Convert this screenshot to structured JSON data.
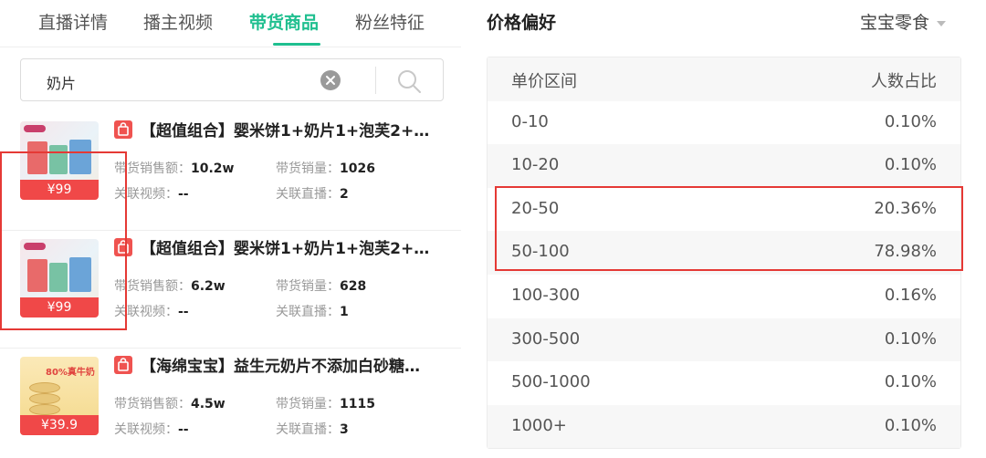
{
  "tabs": [
    {
      "label": "直播详情",
      "active": false
    },
    {
      "label": "播主视频",
      "active": false
    },
    {
      "label": "带货商品",
      "active": true
    },
    {
      "label": "粉丝特征",
      "active": false
    }
  ],
  "search": {
    "value": "奶片"
  },
  "products": [
    {
      "title": "【超值组合】婴米饼1+奶片1+泡芙2+…",
      "price": "¥99",
      "sales_amount_label": "带货销售额：",
      "sales_amount": "10.2w",
      "sales_volume_label": "带货销量：",
      "sales_volume": "1026",
      "linked_videos_label": "关联视频：",
      "linked_videos": "--",
      "linked_lives_label": "关联直播：",
      "linked_lives": "2"
    },
    {
      "title": "【超值组合】婴米饼1+奶片1+泡芙2+…",
      "price": "¥99",
      "sales_amount_label": "带货销售额：",
      "sales_amount": "6.2w",
      "sales_volume_label": "带货销量：",
      "sales_volume": "628",
      "linked_videos_label": "关联视频：",
      "linked_videos": "--",
      "linked_lives_label": "关联直播：",
      "linked_lives": "1"
    },
    {
      "title": "【海绵宝宝】益生元奶片不添加白砂糖…",
      "price": "¥39.9",
      "thumb_tag": "80%真牛奶",
      "sales_amount_label": "带货销售额：",
      "sales_amount": "4.5w",
      "sales_volume_label": "带货销量：",
      "sales_volume": "1115",
      "linked_videos_label": "关联视频：",
      "linked_videos": "--",
      "linked_lives_label": "关联直播：",
      "linked_lives": "3"
    }
  ],
  "price_pref": {
    "title": "价格偏好",
    "category": "宝宝零食",
    "header": {
      "range": "单价区间",
      "ratio": "人数占比"
    },
    "rows": [
      {
        "range": "0-10",
        "ratio": "0.10%"
      },
      {
        "range": "10-20",
        "ratio": "0.10%"
      },
      {
        "range": "20-50",
        "ratio": "20.36%"
      },
      {
        "range": "50-100",
        "ratio": "78.98%"
      },
      {
        "range": "100-300",
        "ratio": "0.16%"
      },
      {
        "range": "300-500",
        "ratio": "0.10%"
      },
      {
        "range": "500-1000",
        "ratio": "0.10%"
      },
      {
        "range": "1000+",
        "ratio": "0.10%"
      }
    ]
  },
  "colors": {
    "accent": "#1fbf8f",
    "price_red": "#f04848",
    "highlight_red": "#e53935"
  }
}
